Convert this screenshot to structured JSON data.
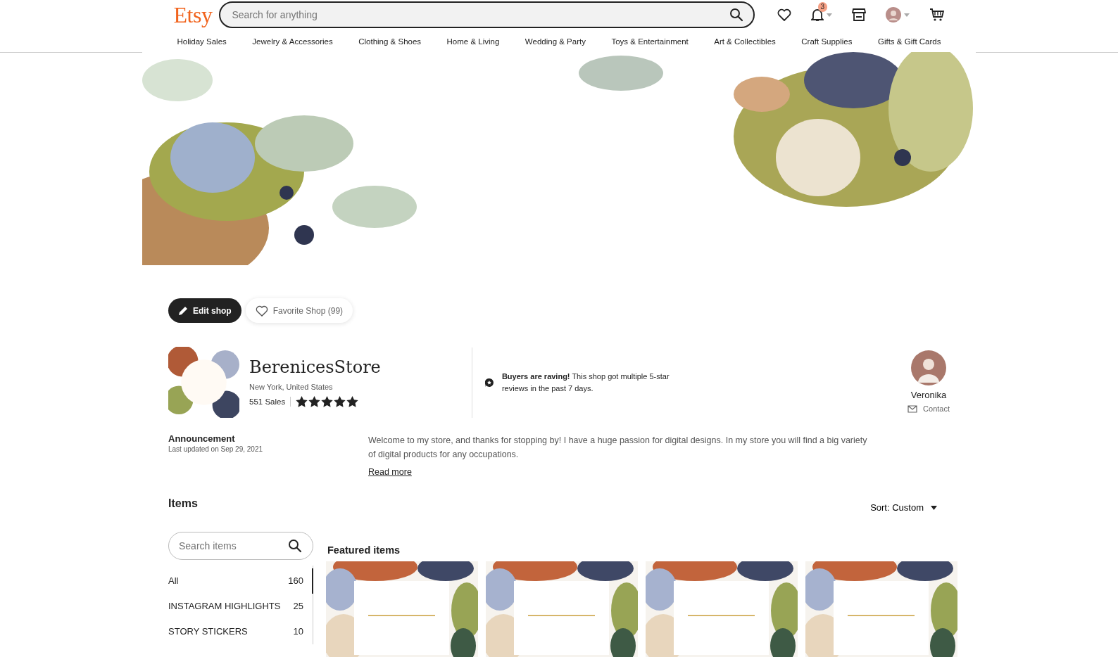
{
  "header": {
    "logo": "Etsy",
    "search": {
      "placeholder": "Search for anything"
    },
    "notification_count": "3"
  },
  "categories": [
    "Holiday Sales",
    "Jewelry & Accessories",
    "Clothing & Shoes",
    "Home & Living",
    "Wedding & Party",
    "Toys & Entertainment",
    "Art & Collectibles",
    "Craft Supplies",
    "Gifts & Gift Cards"
  ],
  "actions": [
    {
      "label": "Edit shop",
      "kind": "edit"
    },
    {
      "label": "Favorite Shop (99)",
      "kind": "favorite"
    }
  ],
  "shop": {
    "name": "BerenicesStore",
    "location": "New York, United States",
    "sales": "551 Sales",
    "stars": 5
  },
  "highlight": {
    "text": "**Buyers are raving!** This shop got multiple 5-star reviews in the past 7 days."
  },
  "owner": {
    "name": "Veronika",
    "contact": "Contact"
  },
  "announcement": {
    "title": "Announcement",
    "updated": "Last updated on Sep 29, 2021",
    "text": "Welcome to my store, and thanks for stopping by! I have a huge passion for digital designs. In my store you will find a big variety of digital products for any occupations.",
    "link": "Read more"
  },
  "items": {
    "title": "Items",
    "sort": "Sort: Custom",
    "search": {
      "placeholder": "Search items"
    },
    "sections": [
      {
        "label": "All",
        "count": "160",
        "selected": true
      },
      {
        "label": "INSTAGRAM HIGHLIGHTS",
        "count": "25",
        "selected": false
      },
      {
        "label": "STORY STICKERS",
        "count": "10",
        "selected": false
      }
    ],
    "featured_title": "Featured items"
  }
}
